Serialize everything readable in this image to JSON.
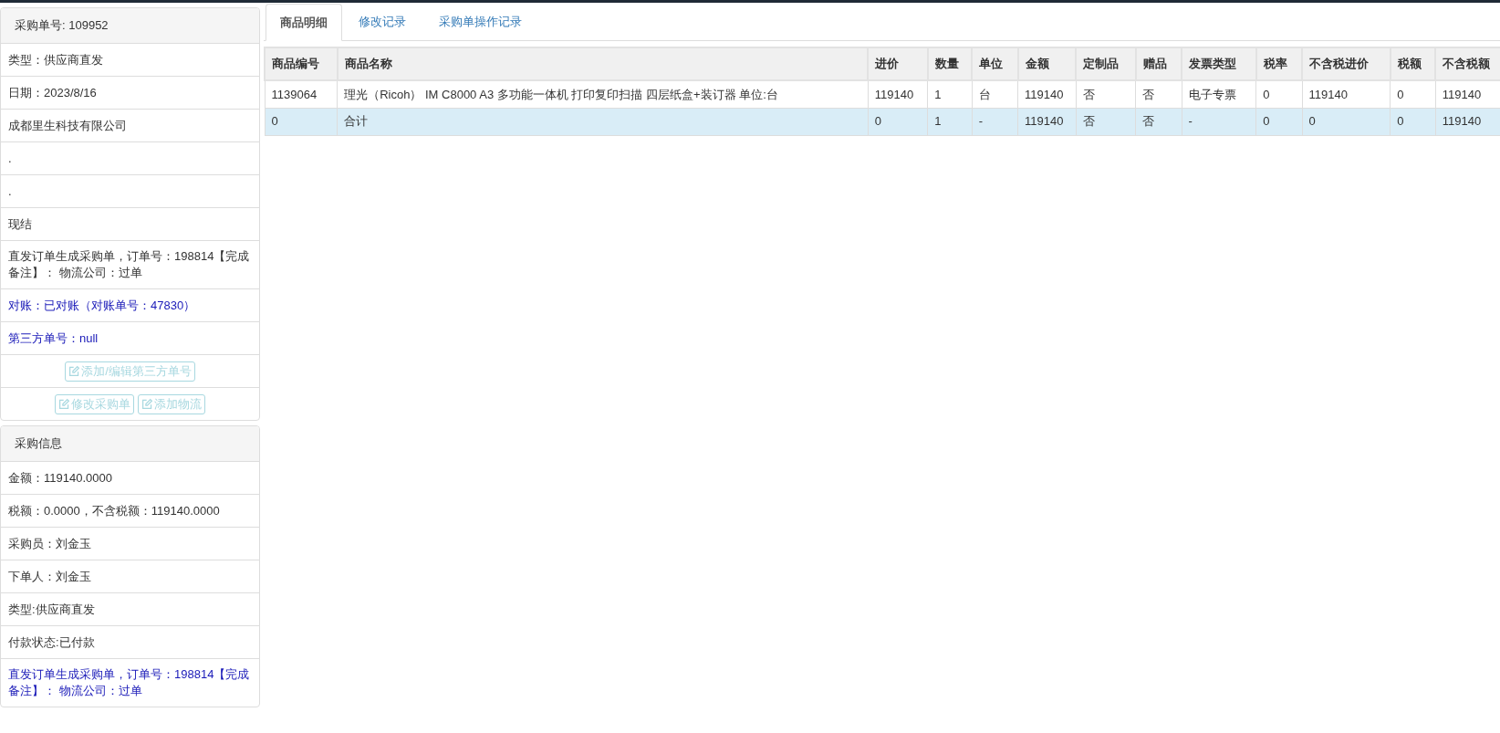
{
  "order_panel": {
    "title": "采购单号: 109952",
    "items": [
      {
        "kind": "text",
        "text": "类型：供应商直发"
      },
      {
        "kind": "text",
        "text": "日期：2023/8/16"
      },
      {
        "kind": "text",
        "text": "成都里生科技有限公司"
      },
      {
        "kind": "text",
        "text": "."
      },
      {
        "kind": "text",
        "text": "."
      },
      {
        "kind": "text",
        "text": "现结"
      },
      {
        "kind": "text",
        "text": "直发订单生成采购单，订单号：198814【完成备注】： 物流公司：过单"
      },
      {
        "kind": "link",
        "text": "对账：已对账（对账单号：47830）"
      },
      {
        "kind": "link",
        "text": "第三方单号：null"
      },
      {
        "kind": "actions",
        "buttons": [
          "添加/编辑第三方单号"
        ]
      },
      {
        "kind": "actions",
        "buttons": [
          "修改采购单",
          "添加物流"
        ]
      }
    ]
  },
  "purchase_panel": {
    "title": "采购信息",
    "items": [
      {
        "kind": "text",
        "text": "金额：119140.0000"
      },
      {
        "kind": "text",
        "text": "税额：0.0000，不含税额：119140.0000"
      },
      {
        "kind": "text",
        "text": "采购员：刘金玉"
      },
      {
        "kind": "text",
        "text": "下单人：刘金玉"
      },
      {
        "kind": "text",
        "text": "类型:供应商直发"
      },
      {
        "kind": "text",
        "text": "付款状态:已付款"
      },
      {
        "kind": "link",
        "text": "直发订单生成采购单，订单号：198814【完成备注】： 物流公司：过单"
      }
    ]
  },
  "tabs": [
    {
      "label": "商品明细",
      "selected": true
    },
    {
      "label": "修改记录",
      "selected": false
    },
    {
      "label": "采购单操作记录",
      "selected": false
    }
  ],
  "table": {
    "columns": [
      "商品编号",
      "商品名称",
      "进价",
      "数量",
      "单位",
      "金额",
      "定制品",
      "赠品",
      "发票类型",
      "税率",
      "不含税进价",
      "税额",
      "不含税额"
    ],
    "rows": [
      {
        "kind": "item",
        "cells": [
          "1139064",
          "理光（Ricoh） IM C8000 A3 多功能一体机 打印复印扫描 四层纸盒+装订器 单位:台",
          "119140",
          "1",
          "台",
          "119140",
          "否",
          "否",
          "电子专票",
          "0",
          "119140",
          "0",
          "119140"
        ]
      },
      {
        "kind": "total",
        "cells": [
          "0",
          "合计",
          "0",
          "1",
          "-",
          "119140",
          "否",
          "否",
          "-",
          "0",
          "0",
          "0",
          "119140"
        ]
      }
    ]
  }
}
